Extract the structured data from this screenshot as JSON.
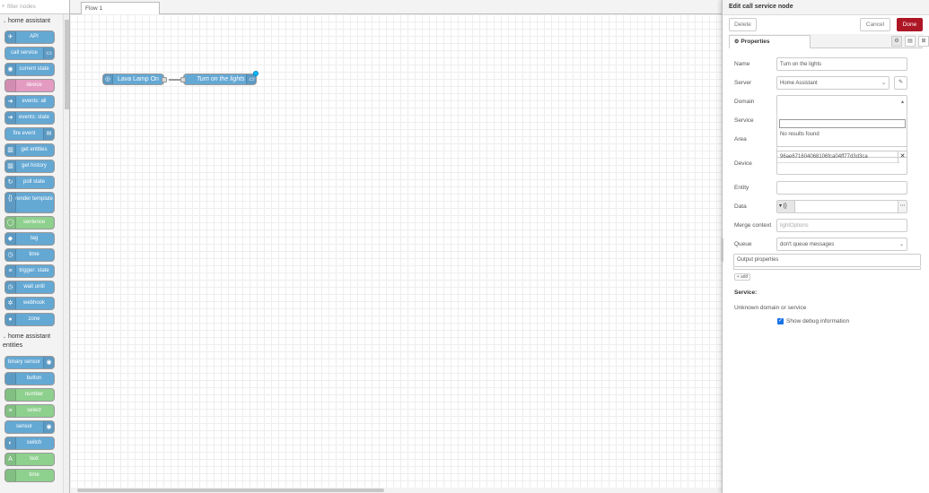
{
  "palette": {
    "filter_placeholder": "filter nodes",
    "categories": [
      {
        "label": "home assistant",
        "nodes": [
          {
            "label": "API",
            "color": "#64a8d4",
            "icon": "✈",
            "icon_name": "paper-plane-icon"
          },
          {
            "label": "call service",
            "color": "#64a8d4",
            "icon": "▭",
            "icon_name": "router-icon",
            "icon_right": true
          },
          {
            "label": "current state",
            "color": "#64a8d4",
            "icon": "◉",
            "icon_name": "eye-icon"
          },
          {
            "label": "device",
            "color": "#e49bc2",
            "icon": "",
            "icon_name": "device-icon"
          },
          {
            "label": "events: all",
            "color": "#64a8d4",
            "icon": "➜",
            "icon_name": "arrow-icon"
          },
          {
            "label": "events: state",
            "color": "#64a8d4",
            "icon": "➜",
            "icon_name": "arrow-icon"
          },
          {
            "label": "fire event",
            "color": "#64a8d4",
            "icon": "✉",
            "icon_name": "event-icon",
            "icon_right": true
          },
          {
            "label": "get entities",
            "color": "#64a8d4",
            "icon": "▥",
            "icon_name": "entities-icon"
          },
          {
            "label": "get history",
            "color": "#64a8d4",
            "icon": "▥",
            "icon_name": "history-icon"
          },
          {
            "label": "poll state",
            "color": "#64a8d4",
            "icon": "↻",
            "icon_name": "refresh-icon"
          },
          {
            "label": "render template",
            "color": "#64a8d4",
            "icon": "{}",
            "icon_name": "template-icon",
            "tall": true
          },
          {
            "label": "sentence",
            "color": "#8ed08e",
            "icon": "◯",
            "icon_name": "chat-icon"
          },
          {
            "label": "tag",
            "color": "#64a8d4",
            "icon": "◆",
            "icon_name": "tag-icon"
          },
          {
            "label": "time",
            "color": "#64a8d4",
            "icon": "◷",
            "icon_name": "clock-icon"
          },
          {
            "label": "trigger: state",
            "color": "#64a8d4",
            "icon": "≡",
            "icon_name": "trigger-icon"
          },
          {
            "label": "wait until",
            "color": "#64a8d4",
            "icon": "◷",
            "icon_name": "timer-icon"
          },
          {
            "label": "webhook",
            "color": "#64a8d4",
            "icon": "✲",
            "icon_name": "webhook-icon"
          },
          {
            "label": "zone",
            "color": "#64a8d4",
            "icon": "●",
            "icon_name": "location-pin-icon"
          }
        ]
      },
      {
        "label": "home assistant entities",
        "nodes": [
          {
            "label": "binary sensor",
            "color": "#64a8d4",
            "icon": "◉",
            "icon_name": "sensor-icon",
            "icon_right": true
          },
          {
            "label": "button",
            "color": "#64a8d4",
            "icon": "",
            "icon_name": "button-icon"
          },
          {
            "label": "number",
            "color": "#8ed08e",
            "icon": "",
            "icon_name": "number-icon"
          },
          {
            "label": "select",
            "color": "#8ed08e",
            "icon": "≡",
            "icon_name": "list-icon"
          },
          {
            "label": "sensor",
            "color": "#64a8d4",
            "icon": "◉",
            "icon_name": "sensor-icon",
            "icon_right": true
          },
          {
            "label": "switch",
            "color": "#64a8d4",
            "icon": "◐",
            "icon_name": "toggle-icon"
          },
          {
            "label": "text",
            "color": "#8ed08e",
            "icon": "A",
            "icon_name": "text-icon"
          },
          {
            "label": "time",
            "color": "#8ed08e",
            "icon": "",
            "icon_name": "time-icon"
          }
        ]
      }
    ]
  },
  "workspace": {
    "tab_label": "Flow 1",
    "nodes": {
      "lava_label": "Lava Lamp On",
      "turn_label": "Turn on the lights"
    }
  },
  "tray": {
    "title": "Edit call service node",
    "delete_label": "Delete",
    "cancel_label": "Cancel",
    "done_label": "Done",
    "properties_tab": "Properties",
    "fields": {
      "name_label": "Name",
      "name_value": "Turn on the lights",
      "server_label": "Server",
      "server_value": "Home Assistant",
      "domain_label": "Domain",
      "domain_value": "",
      "no_results": "No results found",
      "service_label": "Service",
      "area_label": "Area",
      "device_label": "Device",
      "device_value": "96ae67160406810​6fca04ff77d3d3ca",
      "entity_label": "Entity",
      "data_label": "Data",
      "data_type": "{}",
      "merge_label": "Merge context",
      "merge_placeholder": "lightOptions",
      "queue_label": "Queue",
      "queue_value": "don't queue messages",
      "output_props_label": "Output properties",
      "add_label": "+ add",
      "service_heading": "Service:",
      "unknown_text": "Unknown domain or service",
      "debug_label": "Show debug information"
    }
  }
}
